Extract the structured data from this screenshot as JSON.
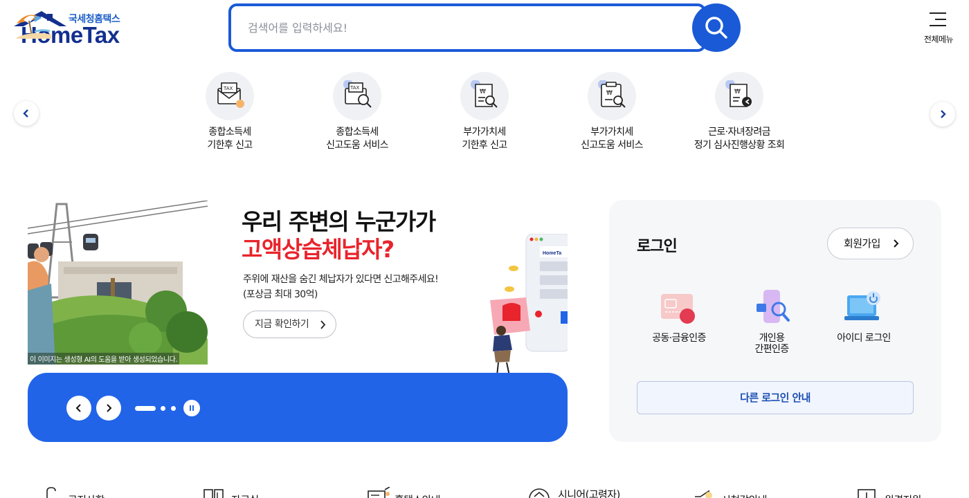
{
  "header": {
    "logo": {
      "sub": "국세청홈택스",
      "main": "HomeTax"
    },
    "search": {
      "placeholder": "검색어를 입력하세요!"
    },
    "menu_label": "전체메뉴"
  },
  "quick_menu": [
    {
      "line1": "종합소득세",
      "line2": "기한후 신고",
      "icon": "tax-envelope-icon"
    },
    {
      "line1": "종합소득세",
      "line2": "신고도움 서비스",
      "icon": "tax-search-icon"
    },
    {
      "line1": "부가가치세",
      "line2": "기한후 신고",
      "icon": "vat-receipt-icon"
    },
    {
      "line1": "부가가치세",
      "line2": "신고도움 서비스",
      "icon": "vat-clipboard-search-icon"
    },
    {
      "line1": "근로·자녀장려금",
      "line2": "정기 심사진행상황 조회",
      "icon": "benefit-receipt-icon"
    }
  ],
  "banner": {
    "title_line1": "우리 주변의 누군가가",
    "title_line2": "고액상습체납자?",
    "desc_line1": "주위에 재산을 숨긴 체납자가 있다면 신고해주세요!",
    "desc_line2": "(포상금 최대 30억)",
    "cta": "지금 확인하기",
    "image_caption": "이 이미지는 생성형 AI의 도움을 받아 생성되었습니다.",
    "slide_count": 3,
    "active_slide": 1,
    "accent_color": "#e8242c",
    "bar_color": "#2164e8"
  },
  "login": {
    "title": "로그인",
    "signup": "회원가입",
    "options": [
      {
        "line1": "공동·금융인증",
        "line2": "",
        "icon": "certificate-icon"
      },
      {
        "line1": "개인용",
        "line2": "간편인증",
        "icon": "simple-auth-icon"
      },
      {
        "line1": "아이디 로그인",
        "line2": "",
        "icon": "id-login-icon"
      }
    ],
    "other": "다른 로그인 안내"
  },
  "bottom_menu": [
    {
      "label": "공지사항",
      "icon": "notice-icon"
    },
    {
      "label": "자료실",
      "icon": "archive-icon"
    },
    {
      "label": "홈택스안내",
      "icon": "guide-icon"
    },
    {
      "label": "시니어(고령자)",
      "icon": "senior-icon"
    },
    {
      "label": "시청각안내",
      "icon": "audio-visual-icon"
    },
    {
      "label": "원격지원",
      "icon": "remote-support-icon"
    }
  ],
  "colors": {
    "brand_blue": "#1a5ad7",
    "logo_navy": "#13308f"
  }
}
